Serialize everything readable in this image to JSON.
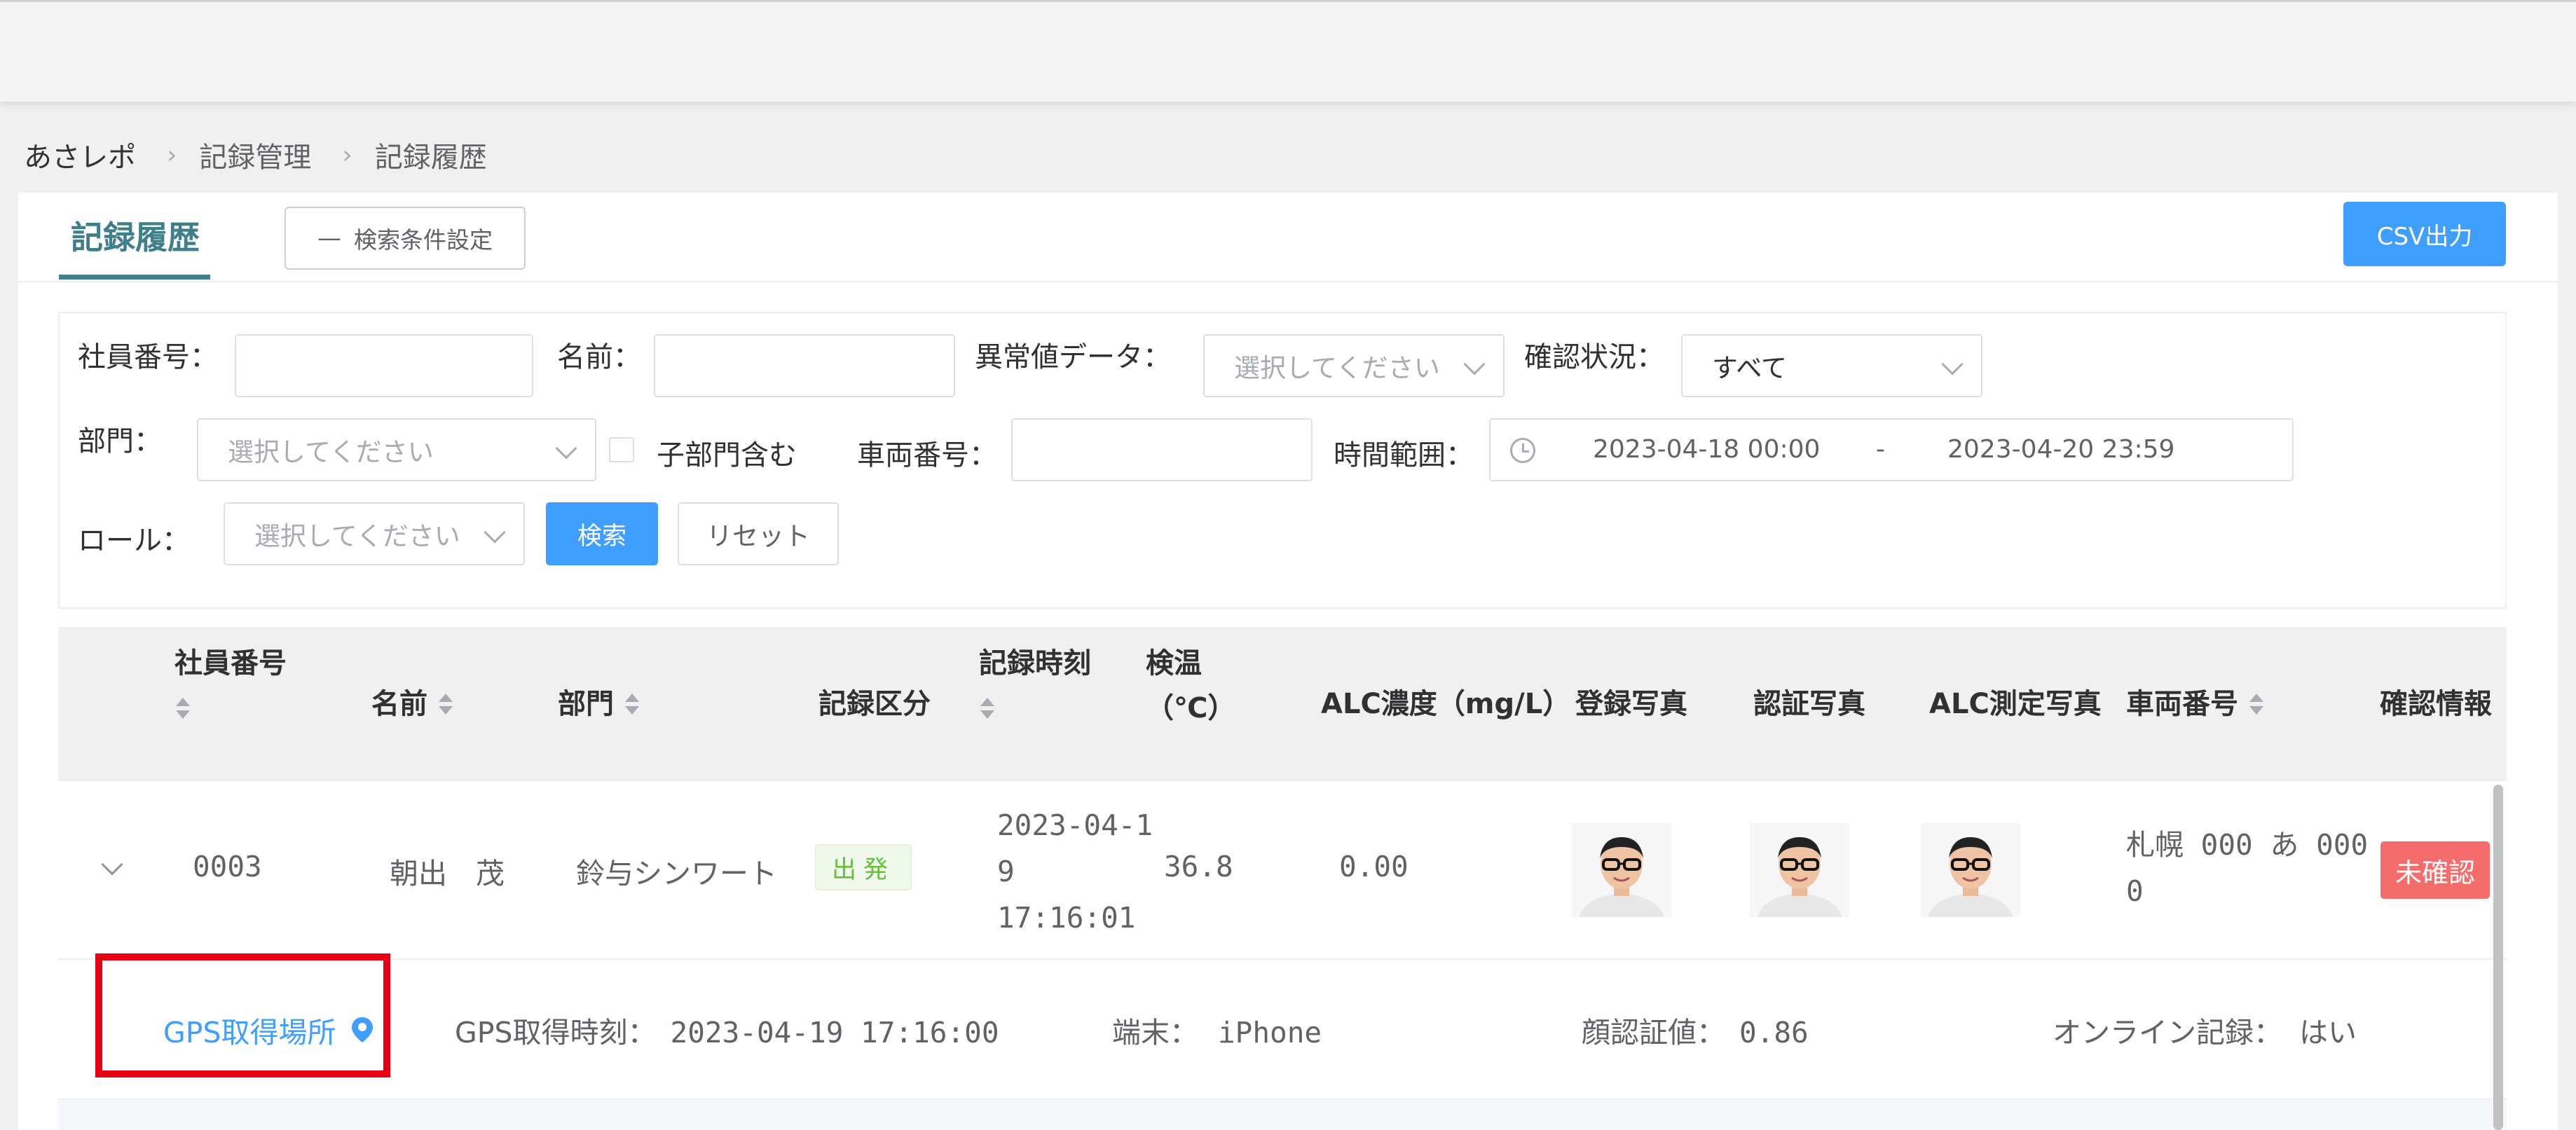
{
  "breadcrumb": {
    "home": "あさレポ",
    "items": [
      "記録管理",
      "記録履歴"
    ]
  },
  "tab": {
    "title": "記録履歴"
  },
  "toolbar": {
    "search_conditions_label": "検索条件設定",
    "csv_label": "CSV出力"
  },
  "filters": {
    "employee_no_label": "社員番号：",
    "name_label": "名前：",
    "anomaly_label": "異常値データ：",
    "anomaly_placeholder": "選択してください",
    "confirm_status_label": "確認状況：",
    "confirm_status_value": "すべて",
    "department_label": "部門：",
    "department_placeholder": "選択してください",
    "include_sub_label": "子部門含む",
    "vehicle_no_label": "車両番号：",
    "time_range_label": "時間範囲：",
    "time_start": "2023-04-18 00:00",
    "time_sep": "-",
    "time_end": "2023-04-20 23:59",
    "role_label": "ロール：",
    "role_placeholder": "選択してください",
    "search_button": "検索",
    "reset_button": "リセット"
  },
  "table": {
    "headers": {
      "employee_no": "社員番号",
      "name": "名前",
      "department": "部門",
      "record_type": "記録区分",
      "record_time": "記録時刻",
      "temp_line1": "検温",
      "temp_line2": "（℃）",
      "alc": "ALC濃度（mg/L）",
      "reg_photo": "登録写真",
      "auth_photo": "認証写真",
      "alc_photo": "ALC測定写真",
      "vehicle_no": "車両番号",
      "confirm_info": "確認情報"
    },
    "row": {
      "employee_no": "0003",
      "name": "朝出　茂",
      "department": "鈴与シンワート",
      "record_type": "出発",
      "record_time_l1": "2023-04-1",
      "record_time_l2": "9",
      "record_time_l3": "17:16:01",
      "temperature": "36.8",
      "alc": "0.00",
      "vehicle_l1": "札幌 000 あ 000",
      "vehicle_l2": "0",
      "confirm_status": "未確認"
    },
    "detail": {
      "gps_link": "GPS取得場所",
      "gps_time_label": "GPS取得時刻：",
      "gps_time": "2023-04-19 17:16:00",
      "device_label": "端末：",
      "device": "iPhone",
      "face_label": "顔認証値：",
      "face_value": "0.86",
      "online_label": "オンライン記録：",
      "online_value": "はい"
    }
  },
  "colors": {
    "primary": "#409eff",
    "tab_accent": "#3f7f8c",
    "danger": "#f56c6c",
    "success": "#67c23a",
    "highlight": "#e60012"
  }
}
